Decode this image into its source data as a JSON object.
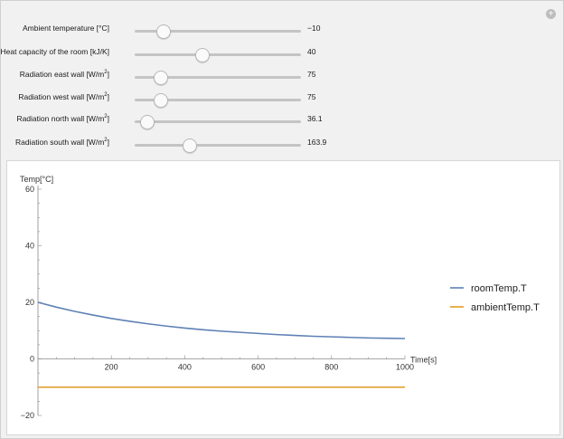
{
  "controls": [
    {
      "label": "Ambient temperature [°C]",
      "value_text": "−10",
      "value": -10,
      "min": -20,
      "max": 40
    },
    {
      "label": "Heat capacity of the room [kJ/K]",
      "value_text": "40",
      "value": 40,
      "min": 0,
      "max": 100
    },
    {
      "label_main": "Radiation east wall [W/m",
      "label_sup": "2",
      "label_end": "]",
      "value_text": "75",
      "value": 75,
      "min": 0,
      "max": 500
    },
    {
      "label_main": "Radiation west wall [W/m",
      "label_sup": "2",
      "label_end": "]",
      "value_text": "75",
      "value": 75,
      "min": 0,
      "max": 500
    },
    {
      "label_main": "Radiation north wall [W/m",
      "label_sup": "2",
      "label_end": "]",
      "value_text": "36.1",
      "value": 36.1,
      "min": 0,
      "max": 500
    },
    {
      "label_main": "Radiation south wall [W/m",
      "label_sup": "2",
      "label_end": "]",
      "value_text": "163.9",
      "value": 163.9,
      "min": 0,
      "max": 500
    }
  ],
  "plus_icon": "plus-icon",
  "chart_data": {
    "type": "line",
    "ylabel": "Temp[°C]",
    "xlabel": "Time[s]",
    "xlim": [
      0,
      1000
    ],
    "ylim": [
      -20,
      60
    ],
    "x_ticks": [
      200,
      400,
      600,
      800,
      1000
    ],
    "y_ticks": [
      -20,
      0,
      20,
      40,
      60
    ],
    "legend_position": "right",
    "series": [
      {
        "name": "roomTemp.T",
        "color": "#5e81b5",
        "x": [
          0,
          50,
          100,
          150,
          200,
          250,
          300,
          350,
          400,
          450,
          500,
          550,
          600,
          650,
          700,
          750,
          800,
          850,
          900,
          950,
          1000
        ],
        "y": [
          20,
          18.3,
          16.8,
          15.5,
          14.3,
          13.3,
          12.4,
          11.6,
          10.9,
          10.3,
          9.8,
          9.4,
          9.0,
          8.6,
          8.3,
          8.0,
          7.8,
          7.6,
          7.4,
          7.3,
          7.2
        ]
      },
      {
        "name": "ambientTemp.T",
        "color": "#e19c24",
        "x": [
          0,
          1000
        ],
        "y": [
          -10,
          -10
        ]
      }
    ]
  }
}
